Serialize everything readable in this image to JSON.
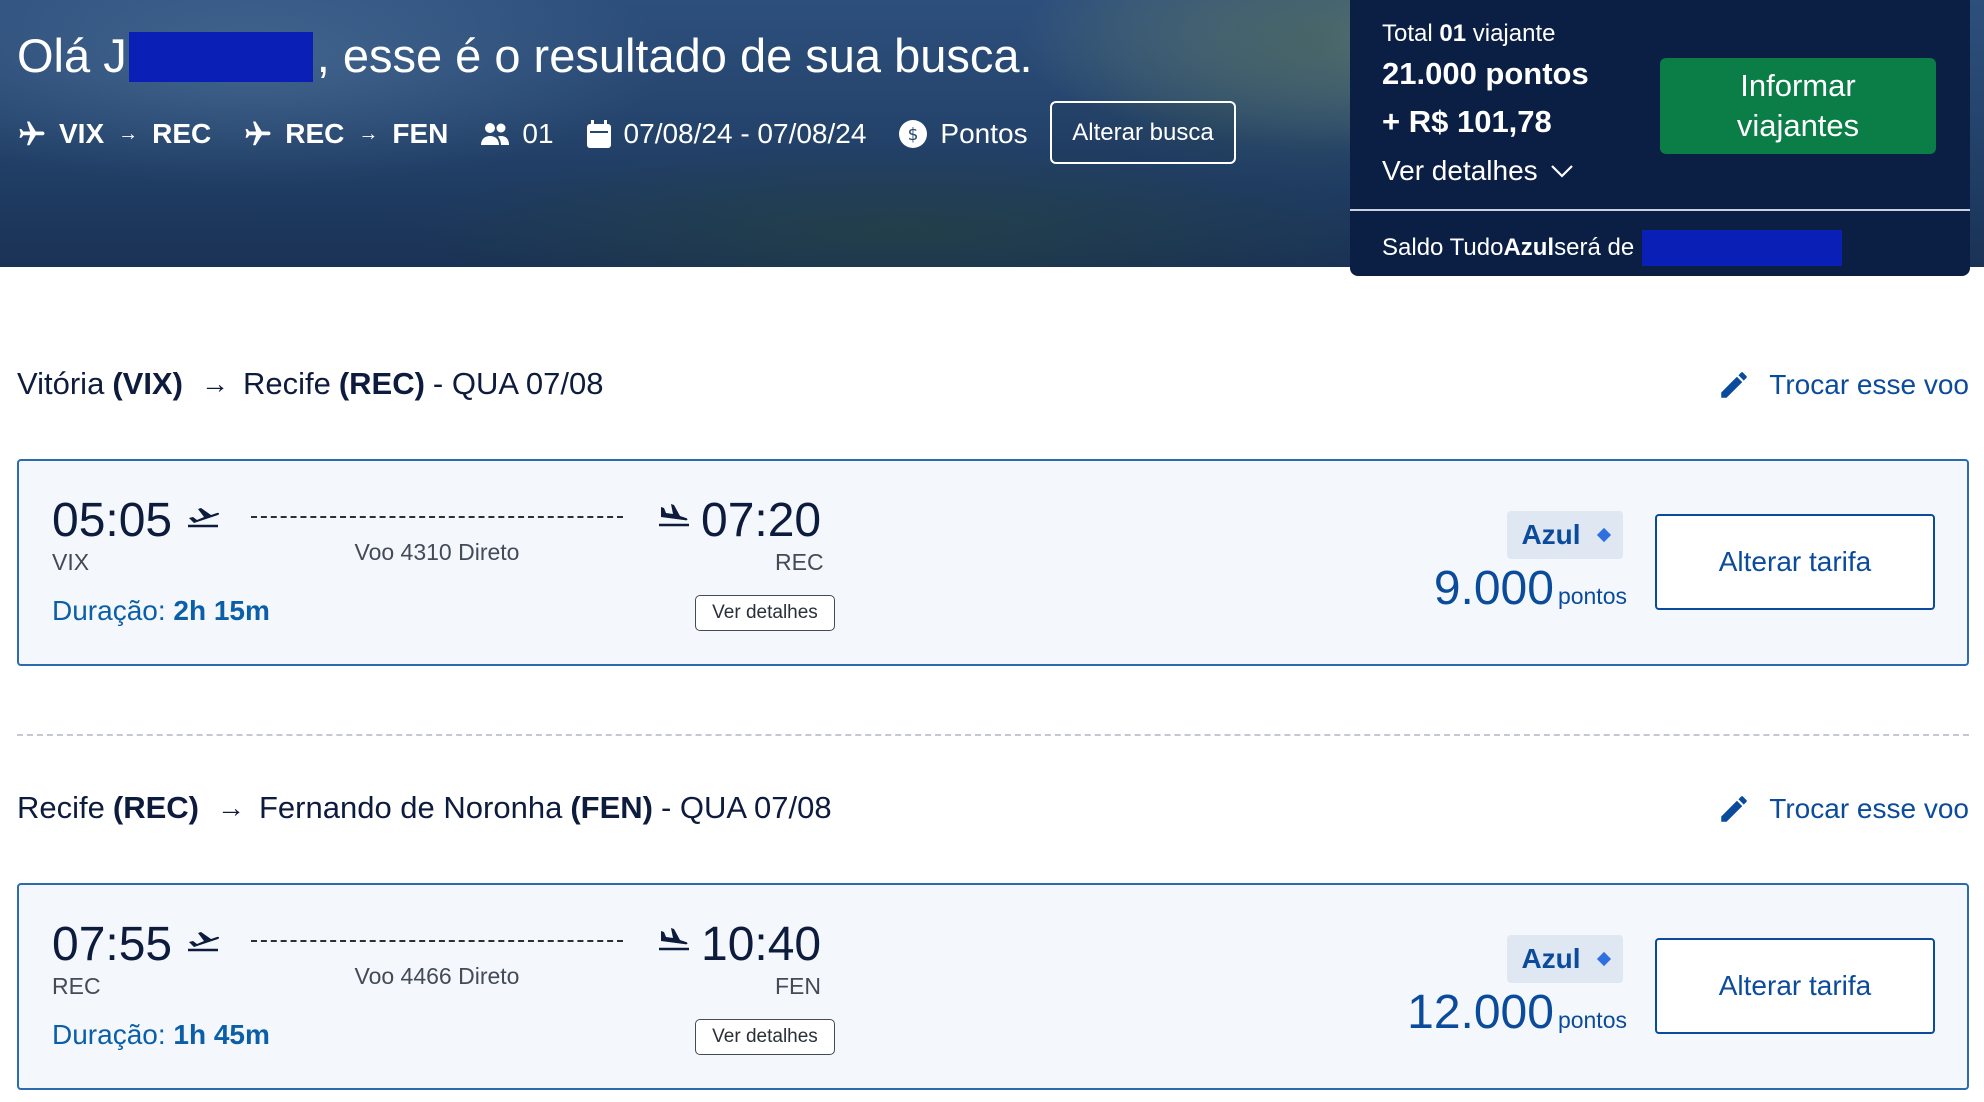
{
  "header": {
    "greeting_prefix": "Olá J",
    "greeting_suffix": ", esse é o resultado de sua busca.",
    "leg1_from": "VIX",
    "leg1_to": "REC",
    "leg2_from": "REC",
    "leg2_to": "FEN",
    "passengers": "01",
    "dates": "07/08/24 - 07/08/24",
    "payment": "Pontos",
    "alter_search": "Alterar busca"
  },
  "total": {
    "label_prefix": "Total ",
    "count": "01",
    "label_suffix": " viajante",
    "points": "21.000 pontos",
    "money": "+ R$ 101,78",
    "details": "Ver detalhes",
    "inform_line1": "Informar",
    "inform_line2": "viajantes",
    "saldo_prefix": "Saldo Tudo",
    "saldo_brand": "Azul",
    "saldo_suffix": " será de"
  },
  "flights": [
    {
      "from_city": "Vitória",
      "from_code": "(VIX)",
      "to_city": "Recife",
      "to_code": "(REC)",
      "date": "- QUA 07/08",
      "swap": "Trocar esse voo",
      "dep_time": "05:05",
      "dep_code": "VIX",
      "arr_time": "07:20",
      "arr_code": "REC",
      "flight": "Voo 4310 Direto",
      "duration_label": "Duração:",
      "duration": "2h 15m",
      "details": "Ver detalhes",
      "fare": "Azul",
      "price": "9.000",
      "price_unit": "pontos",
      "change_fare": "Alterar tarifa"
    },
    {
      "from_city": "Recife",
      "from_code": "(REC)",
      "to_city": "Fernando de Noronha",
      "to_code": "(FEN)",
      "date": "- QUA 07/08",
      "swap": "Trocar esse voo",
      "dep_time": "07:55",
      "dep_code": "REC",
      "arr_time": "10:40",
      "arr_code": "FEN",
      "flight": "Voo 4466 Direto",
      "duration_label": "Duração:",
      "duration": "1h 45m",
      "details": "Ver detalhes",
      "fare": "Azul",
      "price": "12.000",
      "price_unit": "pontos",
      "change_fare": "Alterar tarifa"
    }
  ],
  "icons": {
    "plane": "airplane-icon",
    "people": "people-icon",
    "calendar": "calendar-icon",
    "coin": "coin-icon",
    "chevron": "chevron-down-icon",
    "pencil": "pencil-icon",
    "takeoff": "takeoff-icon",
    "landing": "landing-icon",
    "diamond": "diamond-icon"
  },
  "colors": {
    "panel": "#0b1f45",
    "green": "#0b7d46",
    "accent": "#0b4b9c",
    "redaction": "#0a1fb5"
  }
}
